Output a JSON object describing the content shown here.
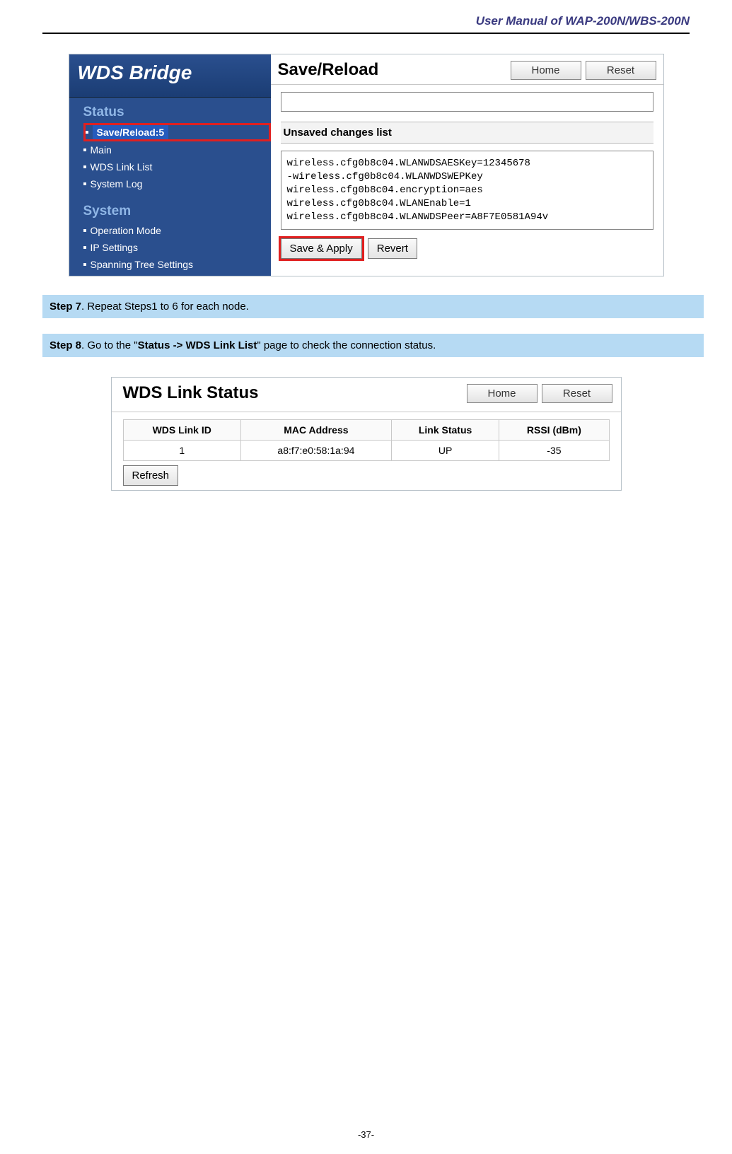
{
  "doc": {
    "header": "User Manual of WAP-200N/WBS-200N",
    "page_number": "-37-"
  },
  "shot1": {
    "side_title": "WDS Bridge",
    "section_status": "Status",
    "section_system": "System",
    "items_status": {
      "save_reload": "Save/Reload:5",
      "main": "Main",
      "wds_link_list": "WDS Link List",
      "system_log": "System Log"
    },
    "items_system": {
      "operation_mode": "Operation Mode",
      "ip_settings": "IP Settings",
      "spanning_tree": "Spanning Tree Settings"
    },
    "main_title": "Save/Reload",
    "btn_home": "Home",
    "btn_reset": "Reset",
    "unsaved_label": "Unsaved changes list",
    "changes": "wireless.cfg0b8c04.WLANWDSAESKey=12345678\n-wireless.cfg0b8c04.WLANWDSWEPKey\nwireless.cfg0b8c04.encryption=aes\nwireless.cfg0b8c04.WLANEnable=1\nwireless.cfg0b8c04.WLANWDSPeer=A8F7E0581A94v",
    "btn_save": "Save & Apply",
    "btn_revert": "Revert"
  },
  "steps": {
    "s7_bold": "Step 7",
    "s7_rest": ". Repeat Steps1 to 6 for each node.",
    "s8_bold": "Step 8",
    "s8_pre": ". Go to the \"",
    "s8_link": "Status -> WDS Link List",
    "s8_post": "\" page to check the connection status."
  },
  "shot2": {
    "title": "WDS Link Status",
    "btn_home": "Home",
    "btn_reset": "Reset",
    "headers": {
      "c1": "WDS Link ID",
      "c2": "MAC Address",
      "c3": "Link Status",
      "c4": "RSSI (dBm)"
    },
    "row": {
      "c1": "1",
      "c2": "a8:f7:e0:58:1a:94",
      "c3": "UP",
      "c4": "-35"
    },
    "btn_refresh": "Refresh"
  }
}
